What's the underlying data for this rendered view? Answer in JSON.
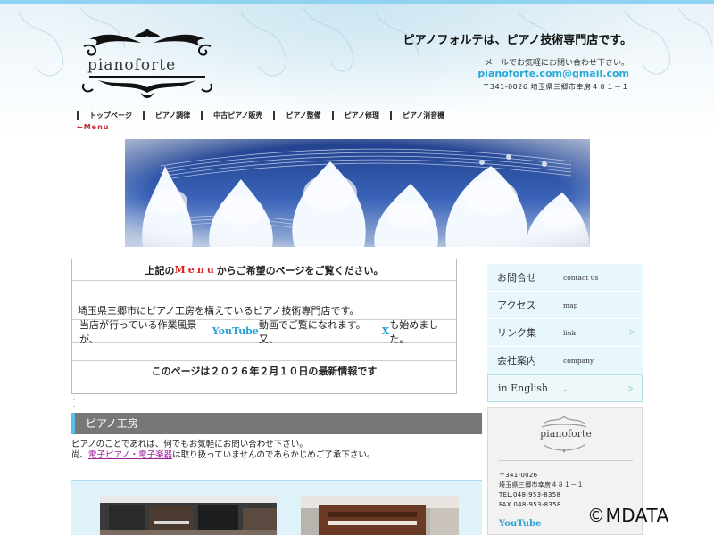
{
  "header": {
    "logo_text": "pianoforte",
    "tagline": "ピアノフォルテは、ピアノ技術専門店です。",
    "contact_note": "メールでお気軽にお問い合わせ下さい。",
    "email": "pianoforte.com@gmail.com",
    "address": "〒341-0026 埼玉県三郷市幸房４８１－１"
  },
  "nav": {
    "items": [
      "トップページ",
      "ピアノ調律",
      "中古ピアノ販売",
      "ピアノ整備",
      "ピアノ修理",
      "ピアノ消音機"
    ],
    "menu_note": "←Menu"
  },
  "info": {
    "row1_a": "上記の",
    "row1_menu": "Menu",
    "row1_b": "からご希望のページをご覧ください。",
    "row3": "埼玉県三郷市にピアノ工房を構えているピアノ技術専門店です。",
    "row4_a": "当店が行っている作業風景が、",
    "row4_yt": "YouTube",
    "row4_b": "動画でご覧になれます。又、",
    "row4_x": "X",
    "row4_c": "も始めました。",
    "row6": "このページは２０２６年２月１０日の最新情報です"
  },
  "section": {
    "title": "ピアノ工房",
    "line1": "ピアノのことであれば、何でもお気軽にお問い合わせ下さい。",
    "line2_a": "尚、",
    "line2_link": "電子ピアノ・電子楽器",
    "line2_b": "は取り扱っていませんのであらかじめご了承下さい。"
  },
  "sidebar": {
    "items": [
      {
        "main": "お問合せ",
        "sub": "contact us"
      },
      {
        "main": "アクセス",
        "sub": "map"
      },
      {
        "main": "リンク集",
        "sub": "link"
      },
      {
        "main": "会社案内",
        "sub": "company"
      },
      {
        "main": "in English",
        "sub": "."
      }
    ]
  },
  "card": {
    "name": "pianoforte",
    "postal": "〒341-0026",
    "address": "埼玉県三郷市幸房４８１－１",
    "tel": "TEL.048-953-8358",
    "fax": "FAX.048-953-8358",
    "youtube": "YouTube"
  },
  "watermark": "©MDATA",
  "colors": {
    "accent_blue": "#2aa8d8",
    "menu_red": "#e02020",
    "section_grey": "#777777",
    "sidebar_bg": "#e8f7fc"
  }
}
